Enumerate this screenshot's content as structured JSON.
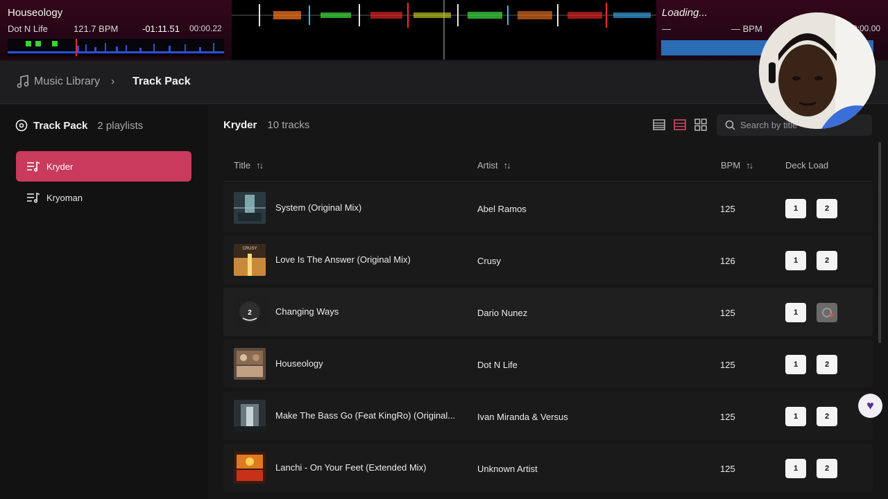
{
  "deck_a": {
    "title": "Houseology",
    "artist": "Dot N Life",
    "bpm": "121.7 BPM",
    "remaining": "-01:11.51",
    "elapsed": "00:00.22"
  },
  "deck_b": {
    "status": "Loading...",
    "artist": "—",
    "bpm": "— BPM",
    "time": "0:00.00"
  },
  "breadcrumb": {
    "library": "Music Library",
    "separator": "›",
    "current": "Track Pack"
  },
  "sidebar": {
    "title": "Track Pack",
    "count": "2 playlists",
    "playlists": [
      {
        "label": "Kryder",
        "active": true
      },
      {
        "label": "Kryoman",
        "active": false
      }
    ]
  },
  "main": {
    "playlist_name": "Kryder",
    "track_count": "10 tracks",
    "search_placeholder": "Search by title",
    "columns": {
      "title": "Title",
      "artist": "Artist",
      "bpm": "BPM",
      "deck_load": "Deck Load"
    },
    "sort_glyph": "↑↓",
    "deck_labels": [
      "1",
      "2"
    ],
    "tracks": [
      {
        "title": "System (Original Mix)",
        "artist": "Abel Ramos",
        "bpm": "125"
      },
      {
        "title": "Love Is The Answer (Original Mix)",
        "artist": "Crusy",
        "bpm": "126"
      },
      {
        "title": "Changing Ways",
        "artist": "Dario Nunez",
        "bpm": "125"
      },
      {
        "title": "Houseology",
        "artist": "Dot N Life",
        "bpm": "125"
      },
      {
        "title": "Make The Bass Go (Feat KingRo) (Original...",
        "artist": "Ivan Miranda & Versus",
        "bpm": "125"
      },
      {
        "title": "Lanchi - On Your Feet (Extended Mix)",
        "artist": "Unknown Artist",
        "bpm": "125"
      }
    ],
    "art_labels": [
      "",
      "CRUSY",
      "2",
      "",
      "",
      ""
    ]
  },
  "colors": {
    "accent": "#c93a5c",
    "deck_b_bar": "#2a6db5"
  },
  "icons": [
    "music-note-icon",
    "chevron-right-icon",
    "vinyl-icon",
    "playlist-icon",
    "list-view-icon",
    "compact-view-icon",
    "grid-view-icon",
    "search-icon",
    "sort-icon",
    "heart-icon"
  ]
}
